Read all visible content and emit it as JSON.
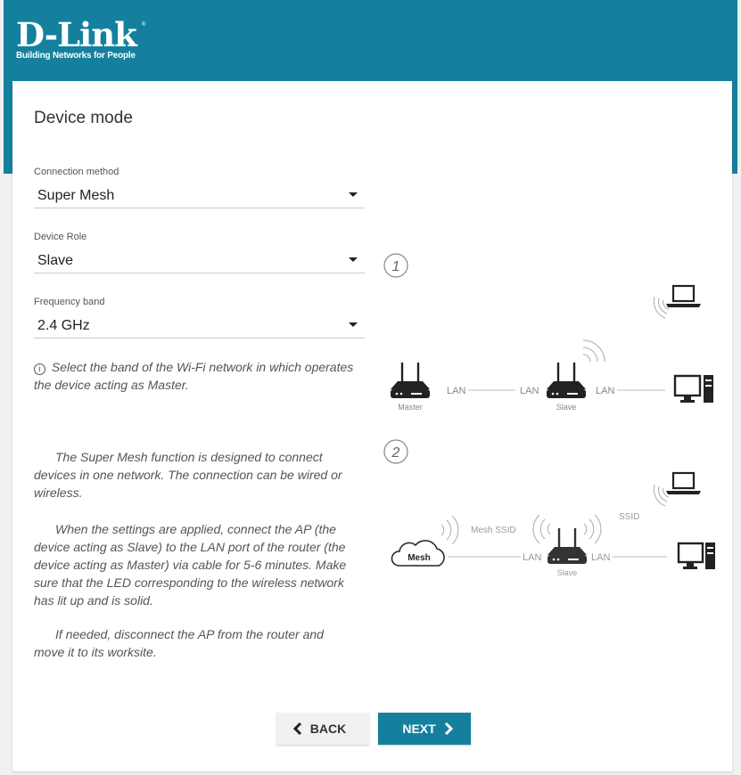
{
  "brand": {
    "logo_text": "D-Link",
    "tagline": "Building Networks for People",
    "primary_color": "#14809e"
  },
  "page": {
    "title": "Device mode"
  },
  "fields": {
    "connection_method": {
      "label": "Connection method",
      "value": "Super Mesh"
    },
    "device_role": {
      "label": "Device Role",
      "value": "Slave"
    },
    "frequency_band": {
      "label": "Frequency band",
      "value": "2.4 GHz"
    }
  },
  "hint": {
    "icon": "info-icon",
    "text": "Select the band of the Wi-Fi network in which operates the device acting as Master."
  },
  "description": [
    "The Super Mesh function is designed to connect devices in one network. The connection can be wired or wireless.",
    "When the settings are applied, connect the AP (the device acting as Slave) to the LAN port of the router (the device acting as Master) via cable for 5-6 minutes. Make sure that the LED corresponding to the wireless network has lit up and is solid.",
    "If needed, disconnect the AP from the router and move it to its worksite."
  ],
  "diagram": {
    "step1_number": "1",
    "step2_number": "2",
    "lan_label": "LAN",
    "master_label": "Master",
    "slave_label": "Slave",
    "mesh_label": "Mesh",
    "mesh_ssid_label": "Mesh SSID",
    "ssid_label": "SSID"
  },
  "buttons": {
    "back_label": "BACK",
    "next_label": "NEXT"
  }
}
